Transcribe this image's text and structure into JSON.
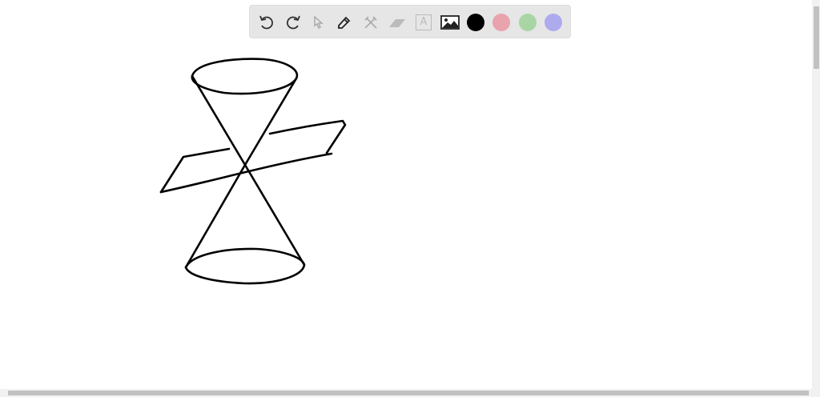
{
  "toolbar": {
    "tools": [
      {
        "name": "undo-icon"
      },
      {
        "name": "redo-icon"
      },
      {
        "name": "select-pointer-icon"
      },
      {
        "name": "pen-icon"
      },
      {
        "name": "tools-icon"
      },
      {
        "name": "eraser-icon"
      },
      {
        "name": "text-icon",
        "glyph": "A"
      },
      {
        "name": "image-icon"
      }
    ],
    "colors": [
      "#000000",
      "#e8a3ad",
      "#a9d5a5",
      "#aeaaee"
    ]
  }
}
